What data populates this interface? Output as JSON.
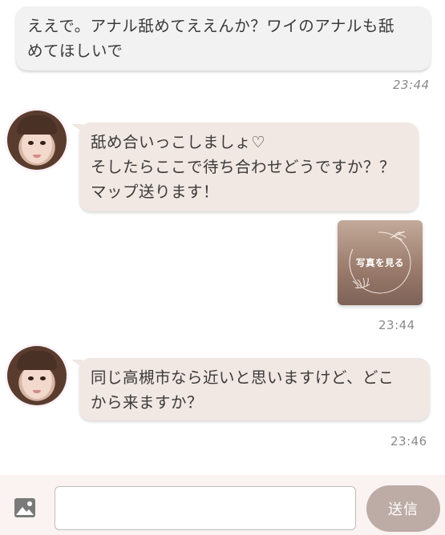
{
  "messages": {
    "outgoing_1": {
      "text": "ええで。アナル舐めてええんか？ワイのアナルも舐\nめてほしいで",
      "time": "23:44"
    },
    "incoming_1": {
      "text": "舐め合いっこしましょ♡\nそしたらここで待ち合わせどうですか？？\nマップ送ります！"
    },
    "photo_card": {
      "label": "写真を見る",
      "time": "23:44"
    },
    "incoming_2": {
      "text": "同じ高槻市なら近いと思いますけど、どこ\nから来ますか？",
      "time": "23:46"
    }
  },
  "footer": {
    "input_value": "",
    "input_placeholder": "",
    "send_label": "送信"
  },
  "icons": {
    "attach": "image-icon",
    "avatar": "avatar"
  },
  "colors": {
    "outgoing_bubble": "#f2f2f2",
    "incoming_bubble": "#f1e7e3",
    "send_button": "#bdaca6",
    "footer_bg": "#faf3f1"
  }
}
